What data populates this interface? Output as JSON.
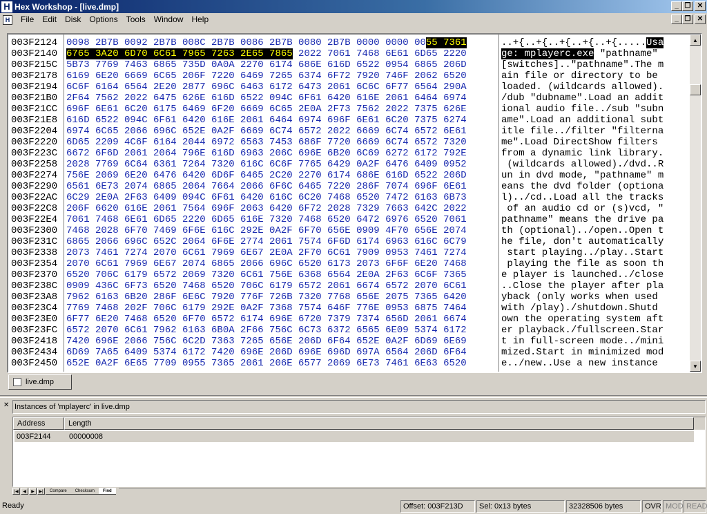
{
  "window": {
    "title": "Hex Workshop - [live.dmp]",
    "app_icon": "H"
  },
  "menu": {
    "items": [
      "File",
      "Edit",
      "Disk",
      "Options",
      "Tools",
      "Window",
      "Help"
    ]
  },
  "hex": {
    "addresses": [
      "003F2124",
      "003F2140",
      "003F215C",
      "003F2178",
      "003F2194",
      "003F21B0",
      "003F21CC",
      "003F21E8",
      "003F2204",
      "003F2220",
      "003F223C",
      "003F2258",
      "003F2274",
      "003F2290",
      "003F22AC",
      "003F22C8",
      "003F22E4",
      "003F2300",
      "003F231C",
      "003F2338",
      "003F2354",
      "003F2370",
      "003F238C",
      "003F23A8",
      "003F23C4",
      "003F23E0",
      "003F23FC",
      "003F2418",
      "003F2434",
      "003F2450"
    ],
    "first_row_hex_normal": "0098 2B7B 0092 2B7B 008C 2B7B 0086 2B7B 0080 2B7B 0000 0000 00",
    "first_row_hex_selected": "55 7361",
    "second_row_hex_selected": "6765 3A20 6D70 6C61 7965 7263 2E65 7865",
    "second_row_hex_normal": " 2022 7061 7468 6E61 6D65 2220",
    "hex_rows": [
      "5B73 7769 7463 6865 735D 0A0A 2270 6174 686E 616D 6522 0954 6865 206D",
      "6169 6E20 6669 6C65 206F 7220 6469 7265 6374 6F72 7920 746F 2062 6520",
      "6C6F 6164 6564 2E20 2877 696C 6463 6172 6473 2061 6C6C 6F77 6564 290A",
      "2F64 7562 2022 6475 626E 616D 6522 094C 6F61 6420 616E 2061 6464 6974",
      "696F 6E61 6C20 6175 6469 6F20 6669 6C65 2E0A 2F73 7562 2022 7375 626E",
      "616D 6522 094C 6F61 6420 616E 2061 6464 6974 696F 6E61 6C20 7375 6274",
      "6974 6C65 2066 696C 652E 0A2F 6669 6C74 6572 2022 6669 6C74 6572 6E61",
      "6D65 2209 4C6F 6164 2044 6972 6563 7453 686F 7720 6669 6C74 6572 7320",
      "6672 6F6D 2061 2064 796E 616D 6963 206C 696E 6B20 6C69 6272 6172 792E",
      "2028 7769 6C64 6361 7264 7320 616C 6C6F 7765 6429 0A2F 6476 6409 0952",
      "756E 2069 6E20 6476 6420 6D6F 6465 2C20 2270 6174 686E 616D 6522 206D",
      "6561 6E73 2074 6865 2064 7664 2066 6F6C 6465 7220 286F 7074 696F 6E61",
      "6C29 2E0A 2F63 6409 094C 6F61 6420 616C 6C20 7468 6520 7472 6163 6B73",
      "206F 6620 616E 2061 7564 696F 2063 6420 6F72 2028 7329 7663 642C 2022",
      "7061 7468 6E61 6D65 2220 6D65 616E 7320 7468 6520 6472 6976 6520 7061",
      "7468 2028 6F70 7469 6F6E 616C 292E 0A2F 6F70 656E 0909 4F70 656E 2074",
      "6865 2066 696C 652C 2064 6F6E 2774 2061 7574 6F6D 6174 6963 616C 6C79",
      "2073 7461 7274 2070 6C61 7969 6E67 2E0A 2F70 6C61 7909 0953 7461 7274",
      "2070 6C61 7969 6E67 2074 6865 2066 696C 6520 6173 2073 6F6F 6E20 7468",
      "6520 706C 6179 6572 2069 7320 6C61 756E 6368 6564 2E0A 2F63 6C6F 7365",
      "0909 436C 6F73 6520 7468 6520 706C 6179 6572 2061 6674 6572 2070 6C61",
      "7962 6163 6B20 286F 6E6C 7920 776F 726B 7320 7768 656E 2075 7365 6420",
      "7769 7468 202F 706C 6179 292E 0A2F 7368 7574 646F 776E 0953 6875 7464",
      "6F77 6E20 7468 6520 6F70 6572 6174 696E 6720 7379 7374 656D 2061 6674",
      "6572 2070 6C61 7962 6163 6B0A 2F66 756C 6C73 6372 6565 6E09 5374 6172",
      "7420 696E 2066 756C 6C2D 7363 7265 656E 206D 6F64 652E 0A2F 6D69 6E69",
      "6D69 7A65 6409 5374 6172 7420 696E 206D 696E 696D 697A 6564 206D 6F64",
      "652E 0A2F 6E65 7709 0955 7365 2061 206E 6577 2069 6E73 7461 6E63 6520"
    ],
    "first_row_ascii_normal": "..+{..+{..+{..+{..+{.....",
    "first_row_ascii_selected": "Usa",
    "second_row_ascii_selected": "ge: mplayerc.exe",
    "second_row_ascii_normal": " \"pathname\" ",
    "ascii_rows": [
      "[switches]..\"pathname\".The m",
      "ain file or directory to be ",
      "loaded. (wildcards allowed).",
      "/dub \"dubname\".Load an addit",
      "ional audio file../sub \"subn",
      "ame\".Load an additional subt",
      "itle file../filter \"filterna",
      "me\".Load DirectShow filters ",
      "from a dynamic link library.",
      " (wildcards allowed)./dvd..R",
      "un in dvd mode, \"pathname\" m",
      "eans the dvd folder (optiona",
      "l)../cd..Load all the tracks",
      " of an audio cd or (s)vcd, \"",
      "pathname\" means the drive pa",
      "th (optional)../open..Open t",
      "he file, don't automatically",
      " start playing../play..Start",
      " playing the file as soon th",
      "e player is launched../close",
      "..Close the player after pla",
      "yback (only works when used ",
      "with /play)./shutdown.Shutd",
      "own the operating system aft",
      "er playback./fullscreen.Star",
      "t in full-screen mode../mini",
      "mized.Start in minimized mod",
      "e../new..Use a new instance "
    ]
  },
  "doc_tab": {
    "label": "live.dmp"
  },
  "results": {
    "title": "Instances of 'mplayerc' in live.dmp",
    "columns": [
      "Address",
      "Length"
    ],
    "rows": [
      {
        "address": "003F2144",
        "length": "00000008"
      }
    ]
  },
  "bottom_tabs": [
    "Compare",
    "Checksum",
    "Find"
  ],
  "status": {
    "ready": "Ready",
    "offset": "Offset: 003F213D",
    "selection": "Sel: 0x13 bytes",
    "size": "32328506 bytes",
    "ovr": "OVR",
    "mod": "MOD",
    "read": "READ"
  }
}
